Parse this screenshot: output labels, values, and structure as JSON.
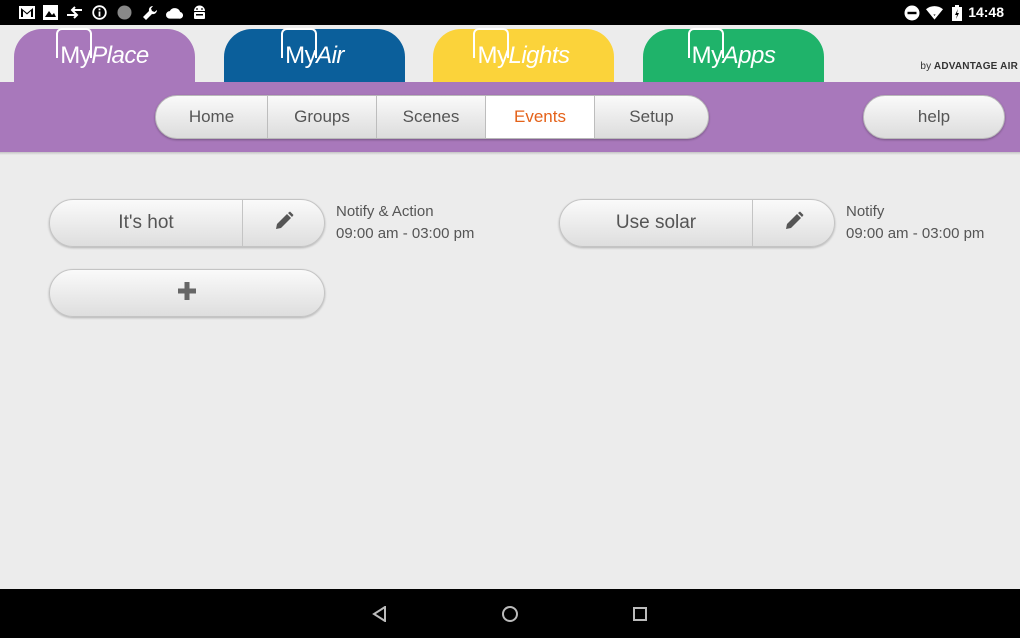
{
  "status_bar": {
    "time": "14:48",
    "left_icons": [
      "gmail-icon",
      "photo-icon",
      "transfer-icon",
      "info-icon",
      "circle-icon",
      "wrench-icon",
      "cloud-icon",
      "android-icon"
    ],
    "right_icons": [
      "do-not-disturb-icon",
      "wifi-icon",
      "battery-icon"
    ]
  },
  "app_tabs": [
    {
      "prefix": "My",
      "suffix": "Place",
      "color": "#a878bb",
      "active": true
    },
    {
      "prefix": "My",
      "suffix": "Air",
      "color": "#0b5f9b",
      "active": false
    },
    {
      "prefix": "My",
      "suffix": "Lights",
      "color": "#fbd33a",
      "active": false
    },
    {
      "prefix": "My",
      "suffix": "Apps",
      "color": "#1fb36a",
      "active": false
    }
  ],
  "brand_credit": {
    "by": "by",
    "name": "ADVANTAGE AIR"
  },
  "nav": {
    "items": [
      "Home",
      "Groups",
      "Scenes",
      "Events",
      "Setup"
    ],
    "active": "Events",
    "help": "help"
  },
  "events": [
    {
      "name": "It's hot",
      "type": "Notify & Action",
      "time": "09:00 am - 03:00 pm"
    },
    {
      "name": "Use solar",
      "type": "Notify",
      "time": "09:00 am - 03:00 pm"
    }
  ],
  "add_button": {
    "icon": "plus-icon"
  },
  "colors": {
    "accent": "#e4621a",
    "purple": "#a878bb",
    "text": "#555555"
  }
}
